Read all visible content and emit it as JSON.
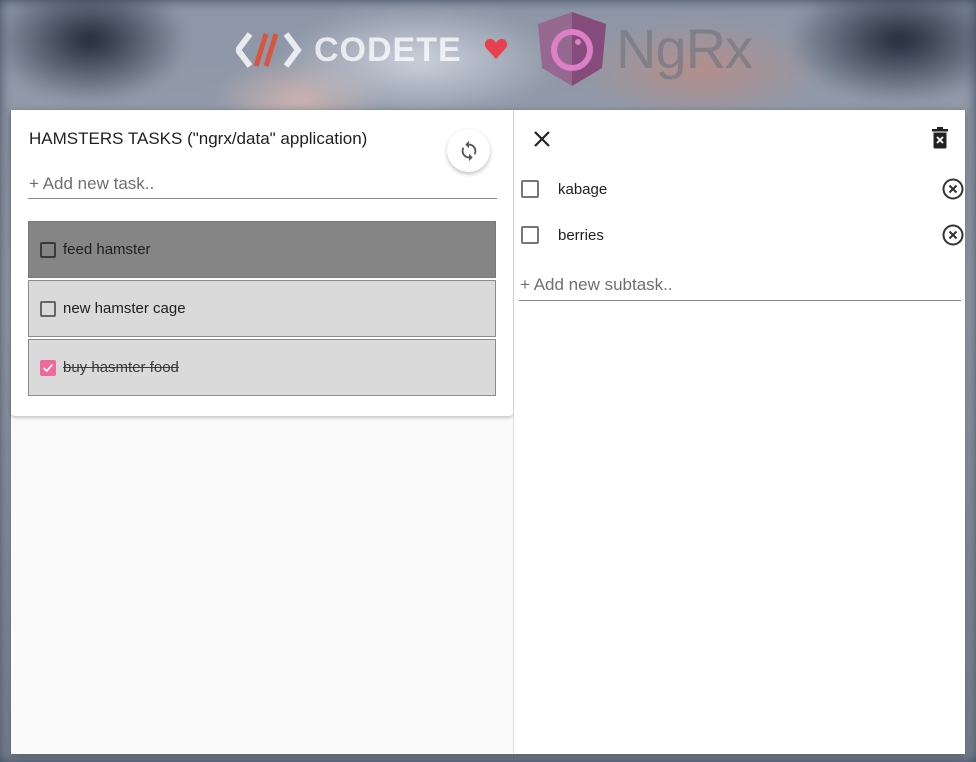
{
  "header": {
    "left_brand": "CODETE",
    "right_brand": "NgRx",
    "heart_color": "#e8404f"
  },
  "tasks_panel": {
    "title": "HAMSTERS TASKS (\"ngrx/data\" application)",
    "new_task_placeholder": "+ Add new task..",
    "refresh_icon": "refresh-icon",
    "tasks": [
      {
        "label": "feed hamster",
        "done": false,
        "selected": true
      },
      {
        "label": "new hamster cage",
        "done": false,
        "selected": false
      },
      {
        "label": "buy hasmter food",
        "done": true,
        "selected": false
      }
    ]
  },
  "subtasks_panel": {
    "close_icon": "close-icon",
    "delete_icon": "trash-icon",
    "subtasks": [
      {
        "label": "kabage",
        "done": false
      },
      {
        "label": "berries",
        "done": false
      }
    ],
    "new_subtask_placeholder": "+ Add new subtask.."
  },
  "colors": {
    "accent_pink": "#ef6a9b",
    "selected_task": "#858585",
    "task_bg": "#dadada"
  }
}
